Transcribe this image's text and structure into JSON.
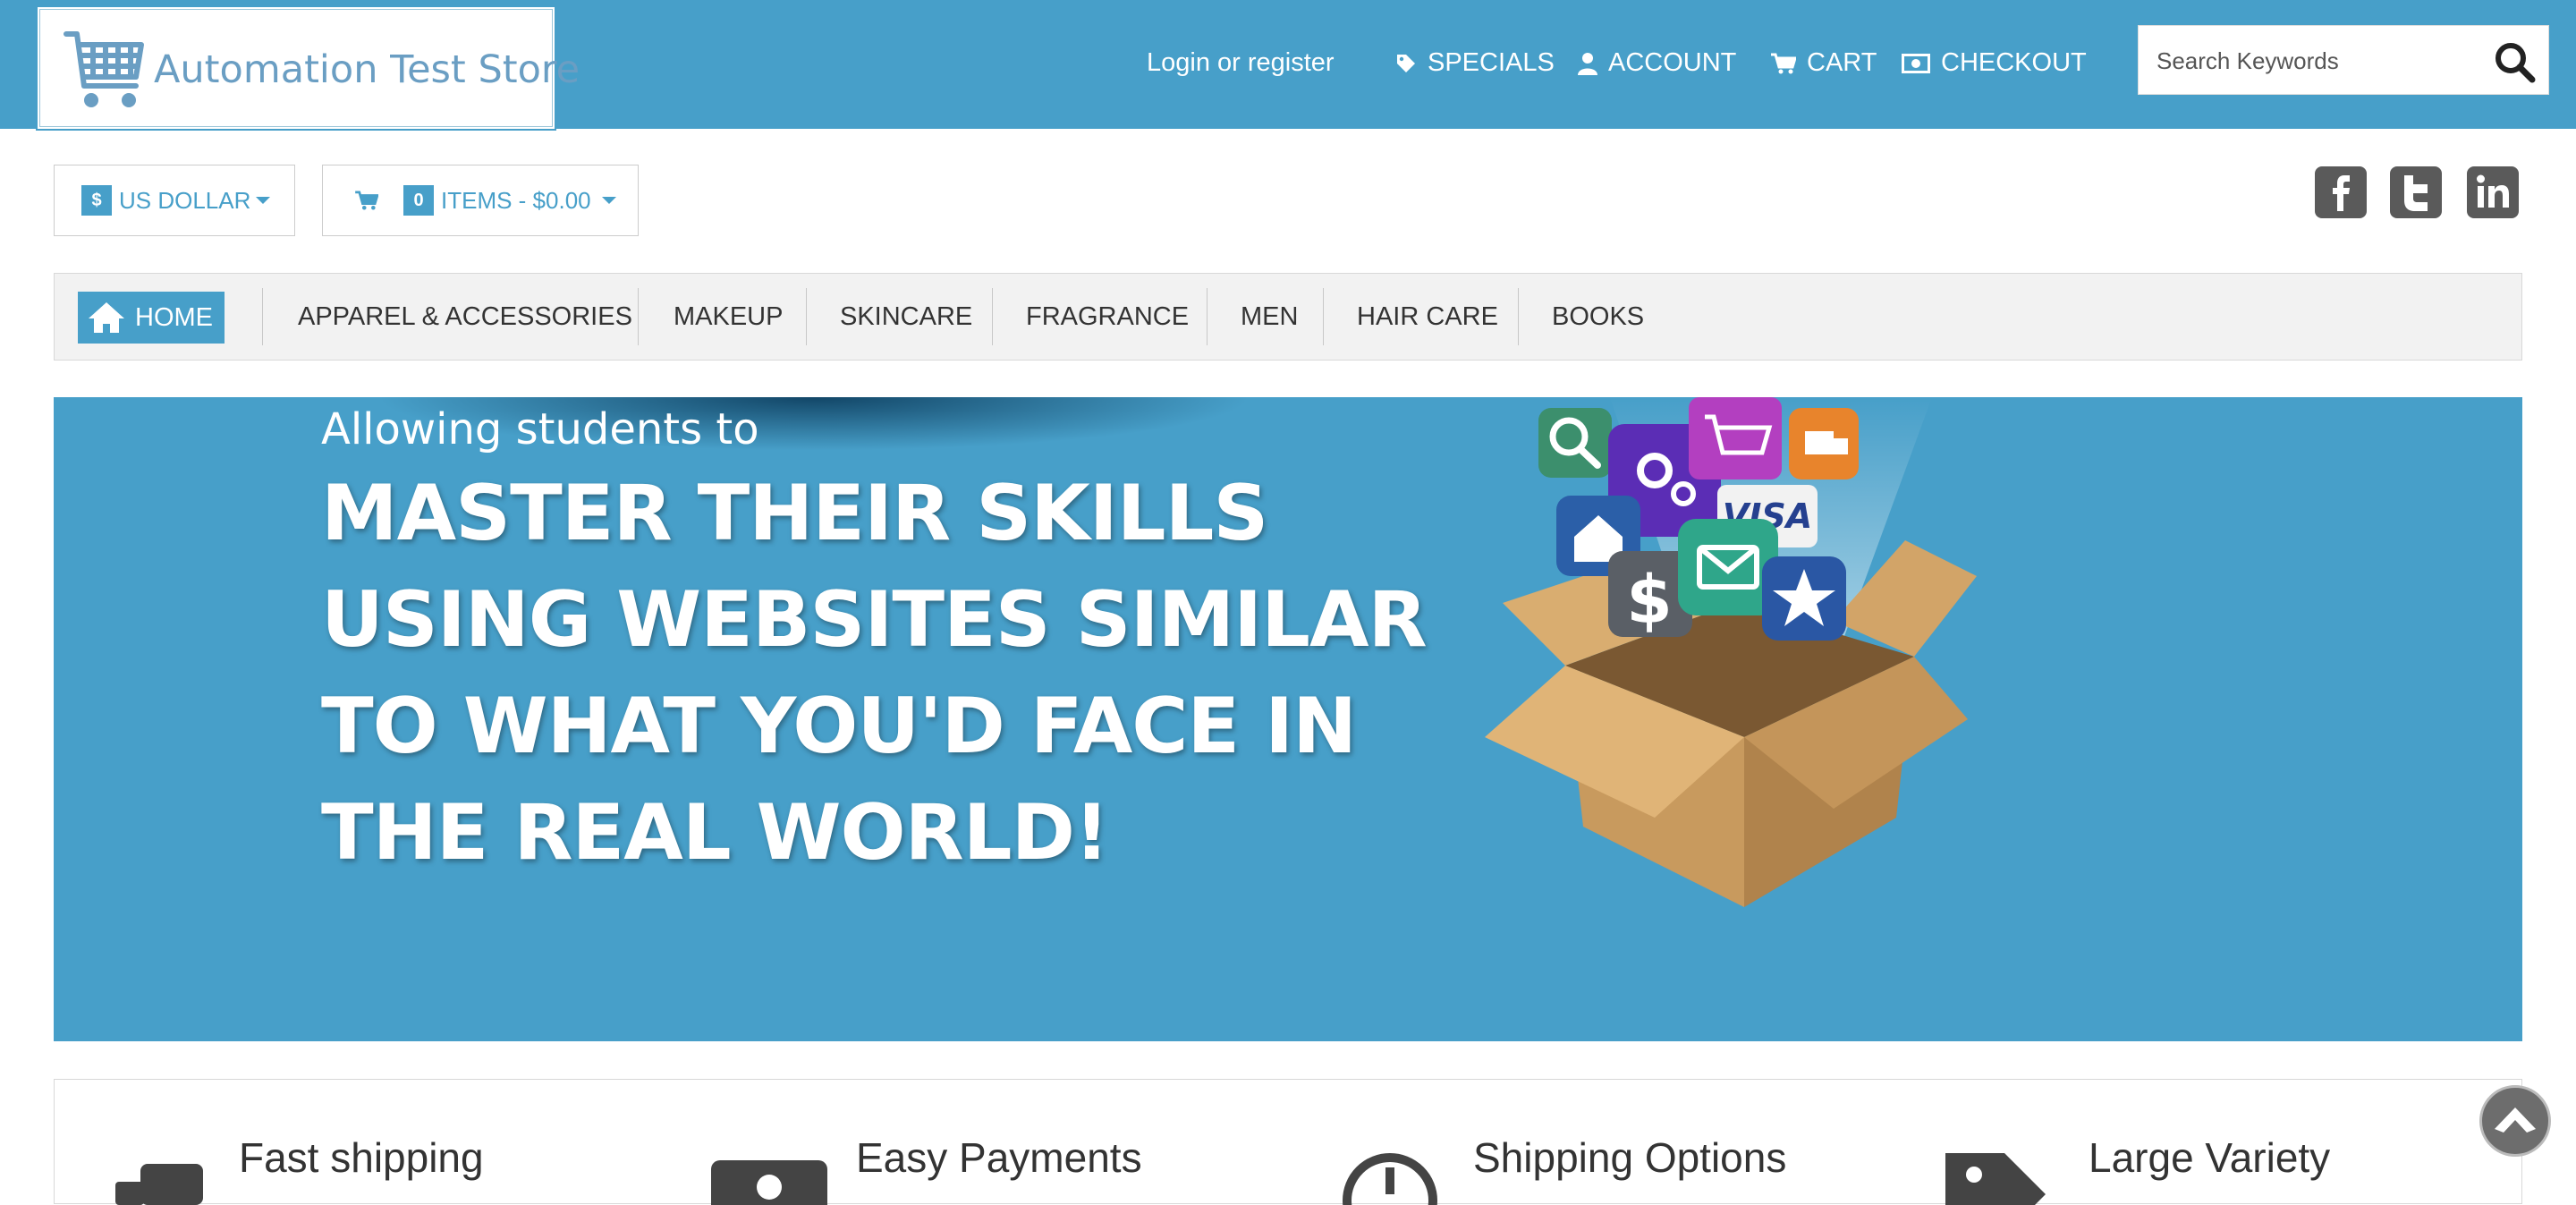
{
  "header": {
    "logo_text": "Automation Test Store",
    "login_link": "Login or register",
    "nav": [
      {
        "label": "SPECIALS",
        "icon": "tag-icon"
      },
      {
        "label": "ACCOUNT",
        "icon": "user-icon"
      },
      {
        "label": "CART",
        "icon": "cart-icon"
      },
      {
        "label": "CHECKOUT",
        "icon": "money-icon"
      }
    ],
    "search": {
      "placeholder": "Search Keywords",
      "value": ""
    }
  },
  "toolbar": {
    "currency_symbol": "$",
    "currency_label": "US DOLLAR",
    "cart_count": "0",
    "cart_label": "ITEMS - $0.00"
  },
  "social": [
    "facebook-icon",
    "twitter-icon",
    "linkedin-icon"
  ],
  "categories": {
    "home": "HOME",
    "items": [
      "APPAREL & ACCESSORIES",
      "MAKEUP",
      "SKINCARE",
      "FRAGRANCE",
      "MEN",
      "HAIR CARE",
      "BOOKS"
    ]
  },
  "banner": {
    "subtitle": "Allowing students to",
    "headline_lines": [
      "MASTER THEIR SKILLS",
      "USING WEBSITES SIMILAR",
      "TO WHAT YOU'D FACE IN",
      "THE REAL WORLD!"
    ]
  },
  "features": [
    {
      "title": "Fast shipping"
    },
    {
      "title": "Easy Payments"
    },
    {
      "title": "Shipping Options"
    },
    {
      "title": "Large Variety"
    }
  ],
  "colors": {
    "primary": "#479fc9",
    "menu_bg": "#f2f2f2",
    "text": "#333333"
  }
}
